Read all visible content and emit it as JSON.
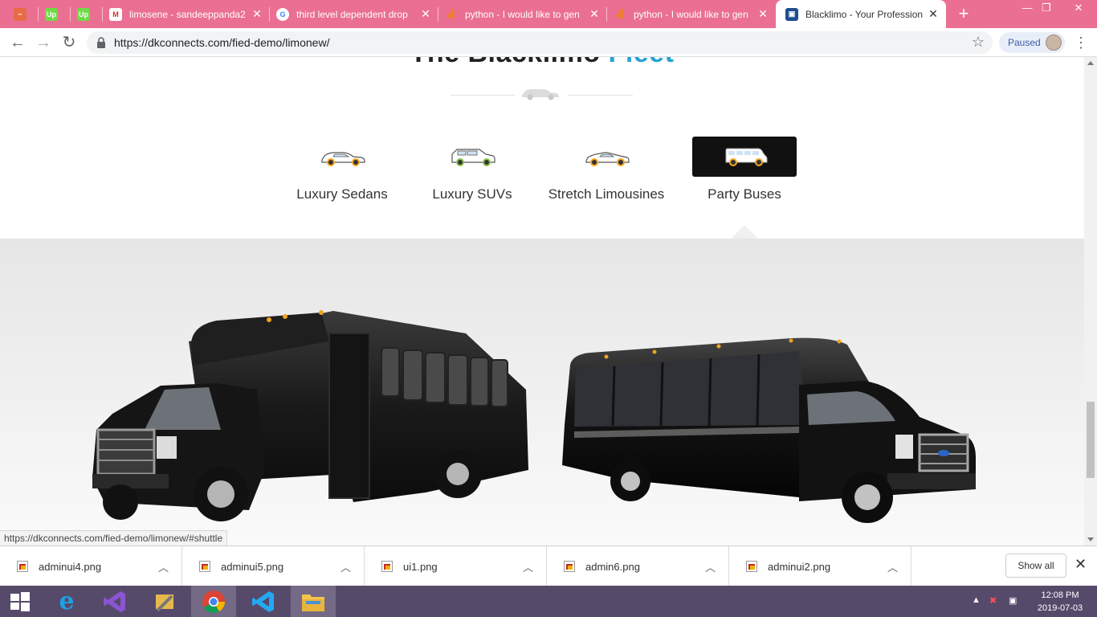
{
  "tabs": [
    {
      "title": "",
      "favicon": "upwork-icon",
      "color": "#e86b45"
    },
    {
      "title": "",
      "favicon": "upwork-icon",
      "color": "#6fda44"
    },
    {
      "title": "",
      "favicon": "upwork-icon",
      "color": "#6fda44"
    },
    {
      "title": "limosene - sandeeppanda2",
      "favicon": "gmail-icon"
    },
    {
      "title": "third level dependent drop",
      "favicon": "google-icon"
    },
    {
      "title": "python - I would like to gen",
      "favicon": "stackoverflow-icon"
    },
    {
      "title": "python - I would like to gen",
      "favicon": "stackoverflow-icon"
    },
    {
      "title": "Blacklimo - Your Profession",
      "favicon": "bus-icon",
      "active": true
    }
  ],
  "toolbar": {
    "url": "https://dkconnects.com/fied-demo/limonew/",
    "paused_label": "Paused"
  },
  "page": {
    "heading_main": "The Blacklimo",
    "heading_accent": "Fleet",
    "accent_color": "#27a3d4",
    "fleet_tabs": [
      {
        "label": "Luxury Sedans",
        "icon": "sedan-icon"
      },
      {
        "label": "Luxury SUVs",
        "icon": "suv-icon"
      },
      {
        "label": "Stretch Limousines",
        "icon": "limousine-icon"
      },
      {
        "label": "Party Buses",
        "icon": "party-bus-icon",
        "active": true
      }
    ],
    "gallery_images": [
      "party-bus-left",
      "party-bus-right"
    ]
  },
  "statusbar": {
    "url": "https://dkconnects.com/fied-demo/limonew/#shuttle"
  },
  "downloads": {
    "items": [
      "adminui4.png",
      "adminui5.png",
      "ui1.png",
      "admin6.png",
      "adminui2.png"
    ],
    "show_all_label": "Show all"
  },
  "taskbar": {
    "apps": [
      "windows-start-icon",
      "internet-explorer-icon",
      "visual-studio-icon",
      "tools-icon",
      "chrome-icon",
      "vscode-icon",
      "file-explorer-icon"
    ],
    "time": "12:08 PM",
    "date": "2019-07-03"
  }
}
